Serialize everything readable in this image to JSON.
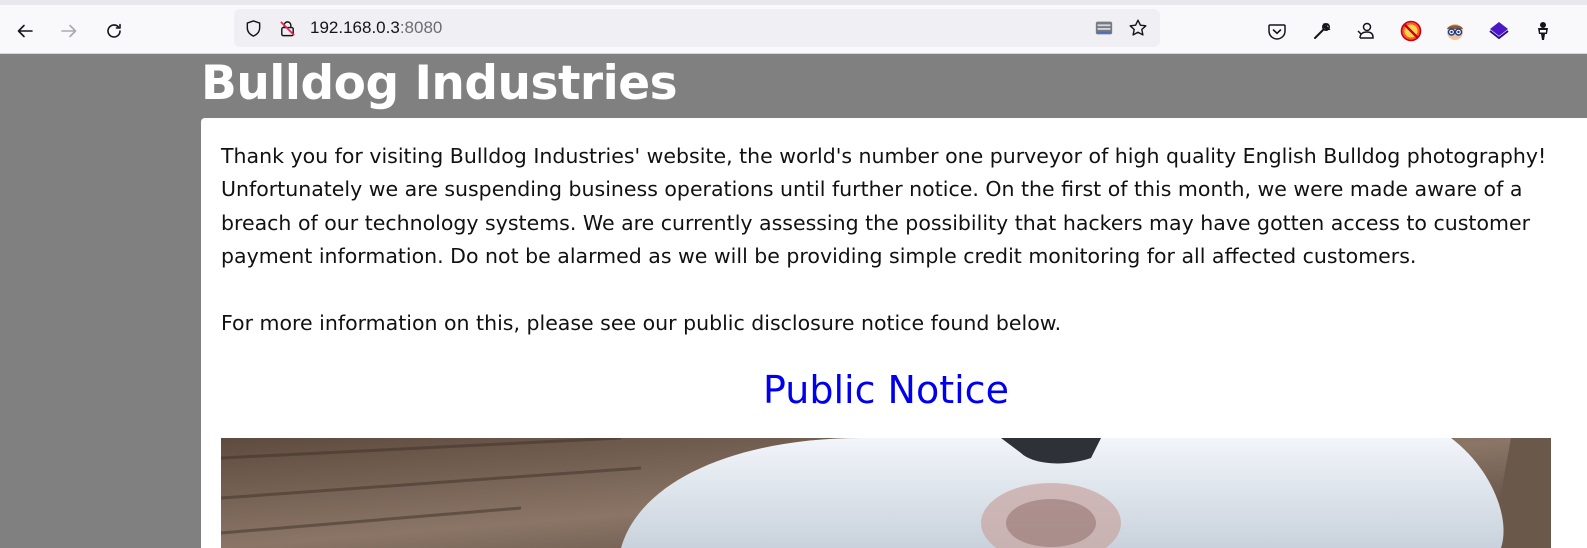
{
  "browser": {
    "url_host": "192.168.0.3",
    "url_port": ":8080",
    "icons": [
      "back-arrow-icon",
      "forward-arrow-icon",
      "reload-icon",
      "shield-icon",
      "insecure-lock-icon",
      "reader-mode-icon",
      "bookmark-star-icon",
      "pocket-icon",
      "wrench-icon",
      "account-icon",
      "blocked-extension-icon",
      "spy-extension-icon",
      "purple-diamond-extension-icon",
      "figure-extension-icon"
    ]
  },
  "site": {
    "title": "Bulldog Industries",
    "paragraph1": "Thank you for visiting Bulldog Industries' website, the world's number one purveyor of high quality English Bulldog photography! Unfortunately we are suspending business operations until further notice. On the first of this month, we were made aware of a breach of our technology systems. We are currently assessing the possibility that hackers may have gotten access to customer payment information. Do not be alarmed as we will be providing simple credit monitoring for all affected customers.",
    "paragraph2": "For more information on this, please see our public disclosure notice found below.",
    "notice_link": "Public Notice"
  },
  "colors": {
    "page_background": "#808080",
    "link": "#0000ee",
    "card": "#ffffff"
  }
}
